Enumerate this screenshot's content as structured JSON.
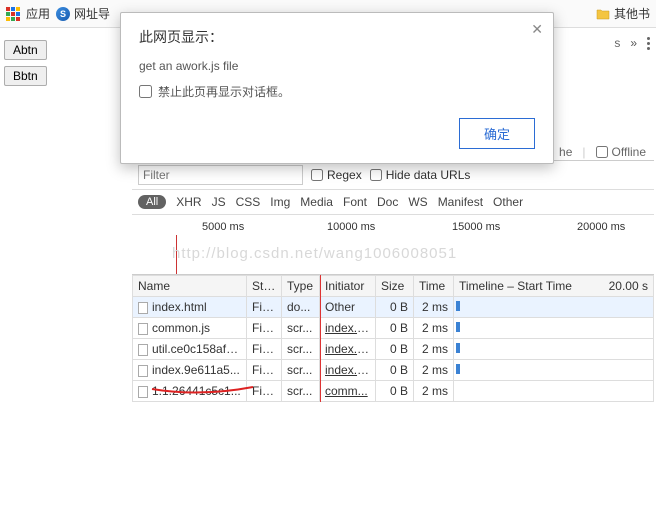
{
  "bookmarks": {
    "apps_label": "应用",
    "nav_label": "网址导",
    "other_label": "其他书"
  },
  "left_buttons": {
    "a": "Abtn",
    "b": "Bbtn"
  },
  "dialog": {
    "title": "此网页显示：",
    "message": "get an awork.js file",
    "suppress_label": "禁止此页再显示对话框。",
    "ok": "确定"
  },
  "top_strip": {
    "s_label": "s",
    "he_label": "he",
    "offline": "Offline"
  },
  "filter": {
    "placeholder": "Filter",
    "regex": "Regex",
    "hide": "Hide data URLs"
  },
  "types": {
    "all": "All",
    "xhr": "XHR",
    "js": "JS",
    "css": "CSS",
    "img": "Img",
    "media": "Media",
    "font": "Font",
    "doc": "Doc",
    "ws": "WS",
    "manifest": "Manifest",
    "other": "Other"
  },
  "ticks": {
    "t1": "5000 ms",
    "t2": "10000 ms",
    "t3": "15000 ms",
    "t4": "20000 ms"
  },
  "watermark": "http://blog.csdn.net/wang1006008051",
  "table": {
    "headers": {
      "name": "Name",
      "status": "Sta...",
      "type": "Type",
      "initiator": "Initiator",
      "size": "Size",
      "time": "Time",
      "timeline": "Timeline – Start Time",
      "right": "20.00 s"
    },
    "rows": [
      {
        "name": "index.html",
        "status": "Fin...",
        "type": "do...",
        "initiator": "Other",
        "init_link": false,
        "size": "0 B",
        "time": "2 ms",
        "bar": true
      },
      {
        "name": "common.js",
        "status": "Fin...",
        "type": "scr...",
        "initiator": "index.h...",
        "init_link": true,
        "size": "0 B",
        "time": "2 ms",
        "bar": true
      },
      {
        "name": "util.ce0c158afa...",
        "status": "Fin...",
        "type": "scr...",
        "initiator": "index.h...",
        "init_link": true,
        "size": "0 B",
        "time": "2 ms",
        "bar": true
      },
      {
        "name": "index.9e611a5...",
        "status": "Fin...",
        "type": "scr...",
        "initiator": "index.h...",
        "init_link": true,
        "size": "0 B",
        "time": "2 ms",
        "bar": true
      },
      {
        "name": "1.1.26441c5c1...",
        "status": "Fin...",
        "type": "scr...",
        "initiator": "comm...",
        "init_link": true,
        "size": "0 B",
        "time": "2 ms",
        "bar": false
      }
    ]
  }
}
